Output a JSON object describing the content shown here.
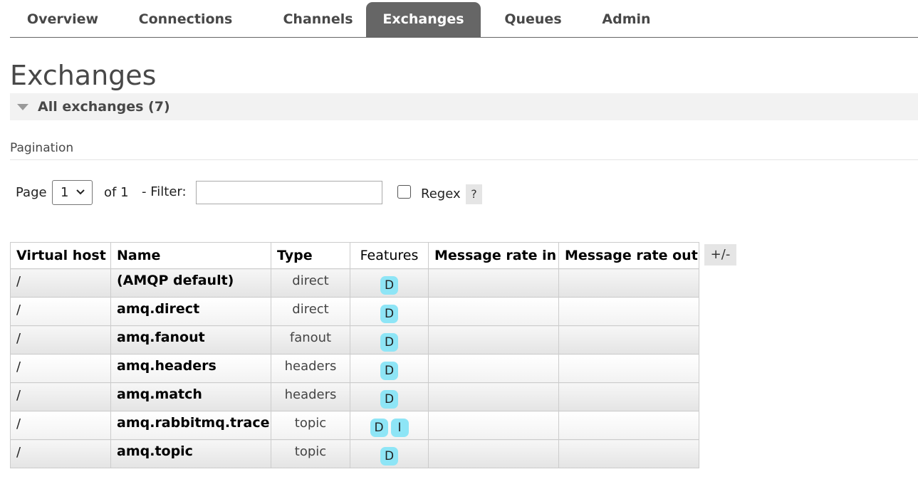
{
  "nav": {
    "tabs": [
      {
        "label": "Overview",
        "active": false
      },
      {
        "label": "Connections",
        "active": false
      },
      {
        "label": "Channels",
        "active": false
      },
      {
        "label": "Exchanges",
        "active": true
      },
      {
        "label": "Queues",
        "active": false
      },
      {
        "label": "Admin",
        "active": false
      }
    ]
  },
  "page": {
    "title": "Exchanges",
    "section_label": "All exchanges (7)"
  },
  "pagination": {
    "label": "Pagination",
    "page_label": "Page",
    "page_value": "1",
    "of_label": "of 1",
    "filter_label": "- Filter:",
    "filter_value": "",
    "regex_label": "Regex",
    "regex_checked": false,
    "help_label": "?"
  },
  "table": {
    "columns": [
      "Virtual host",
      "Name",
      "Type",
      "Features",
      "Message rate in",
      "Message rate out"
    ],
    "columns_toggle": "+/-",
    "rows": [
      {
        "vhost": "/",
        "name": "(AMQP default)",
        "type": "direct",
        "features": [
          "D"
        ]
      },
      {
        "vhost": "/",
        "name": "amq.direct",
        "type": "direct",
        "features": [
          "D"
        ]
      },
      {
        "vhost": "/",
        "name": "amq.fanout",
        "type": "fanout",
        "features": [
          "D"
        ]
      },
      {
        "vhost": "/",
        "name": "amq.headers",
        "type": "headers",
        "features": [
          "D"
        ]
      },
      {
        "vhost": "/",
        "name": "amq.match",
        "type": "headers",
        "features": [
          "D"
        ]
      },
      {
        "vhost": "/",
        "name": "amq.rabbitmq.trace",
        "type": "topic",
        "features": [
          "D",
          "I"
        ]
      },
      {
        "vhost": "/",
        "name": "amq.topic",
        "type": "topic",
        "features": [
          "D"
        ]
      }
    ]
  },
  "colors": {
    "active_tab_bg": "#666666",
    "feature_badge_bg": "#8ee5f6",
    "text": "#484848"
  }
}
